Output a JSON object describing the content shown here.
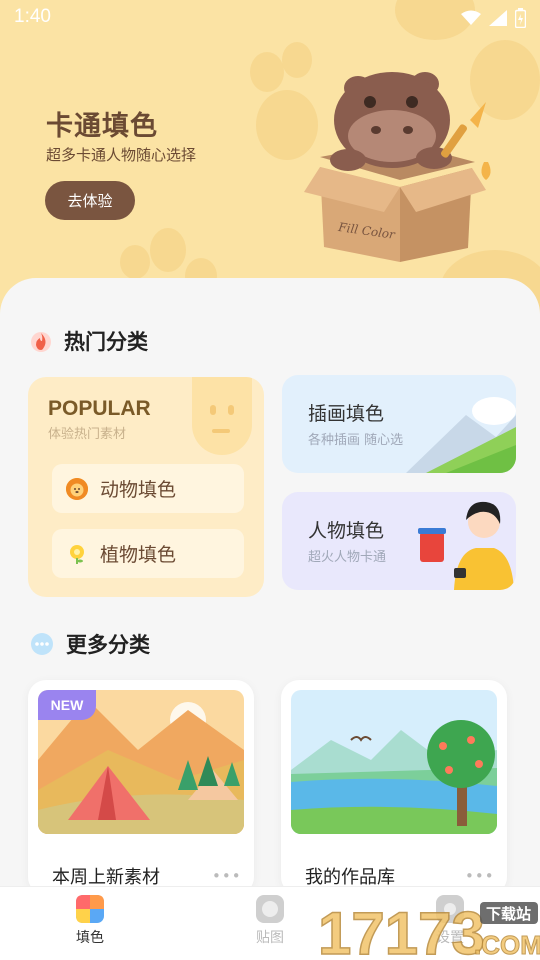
{
  "status_bar": {
    "time": "1:40"
  },
  "hero": {
    "title": "卡通填色",
    "subtitle": "超多卡通人物随心选择",
    "button": "去体验",
    "box_label": "Fill Color"
  },
  "hot_section": {
    "title": "热门分类",
    "popular": {
      "title": "POPULAR",
      "subtitle": "体验热门素材",
      "items": [
        {
          "label": "动物填色",
          "icon": "lion-icon"
        },
        {
          "label": "植物填色",
          "icon": "flower-icon"
        }
      ]
    },
    "side_cards": [
      {
        "title": "插画填色",
        "subtitle": "各种插画 随心选"
      },
      {
        "title": "人物填色",
        "subtitle": "超火人物卡通"
      }
    ]
  },
  "more_section": {
    "title": "更多分类",
    "cards": [
      {
        "label": "本周上新素材",
        "badge": "NEW"
      },
      {
        "label": "我的作品库"
      }
    ]
  },
  "bottom_nav": [
    {
      "label": "填色",
      "active": true
    },
    {
      "label": "贴图",
      "active": false
    },
    {
      "label": "设置",
      "active": false
    }
  ],
  "watermark": {
    "number": "17173",
    "text": "下载站",
    "domain": ".COM"
  },
  "colors": {
    "hero_bg": "#fbe3a4",
    "brown": "#7a5540",
    "popular_bg": "#feecc6",
    "illustration_bg": "#e2f0fc",
    "people_bg": "#e9e8fc",
    "accent_purple": "#9a84ef"
  }
}
